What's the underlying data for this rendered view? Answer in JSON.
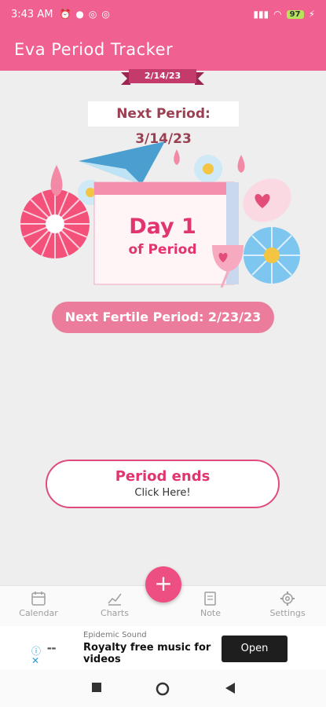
{
  "status": {
    "time": "3:43 AM",
    "battery": "97"
  },
  "app": {
    "title": "Eva Period Tracker"
  },
  "current_date": "2/14/23",
  "next_period": "Next Period: 3/14/23",
  "day_card": {
    "number": "Day 1",
    "subtitle": "of Period"
  },
  "next_fertile": "Next Fertile Period: 2/23/23",
  "period_button": {
    "title": "Period ends",
    "subtitle": "Click Here!"
  },
  "nav": [
    {
      "label": "Calendar",
      "icon": "calendar-icon"
    },
    {
      "label": "Charts",
      "icon": "chart-icon"
    },
    {
      "label": "Note",
      "icon": "note-icon"
    },
    {
      "label": "Settings",
      "icon": "gear-icon"
    }
  ],
  "fab": {
    "symbol": "+"
  },
  "ad": {
    "sponsor": "Epidemic Sound",
    "title": "Royalty free music for videos",
    "button": "Open"
  },
  "colors": {
    "primary": "#f06090",
    "accent": "#e0356f",
    "fertile": "#ec7c9b",
    "ribbon": "#c33a6b"
  }
}
